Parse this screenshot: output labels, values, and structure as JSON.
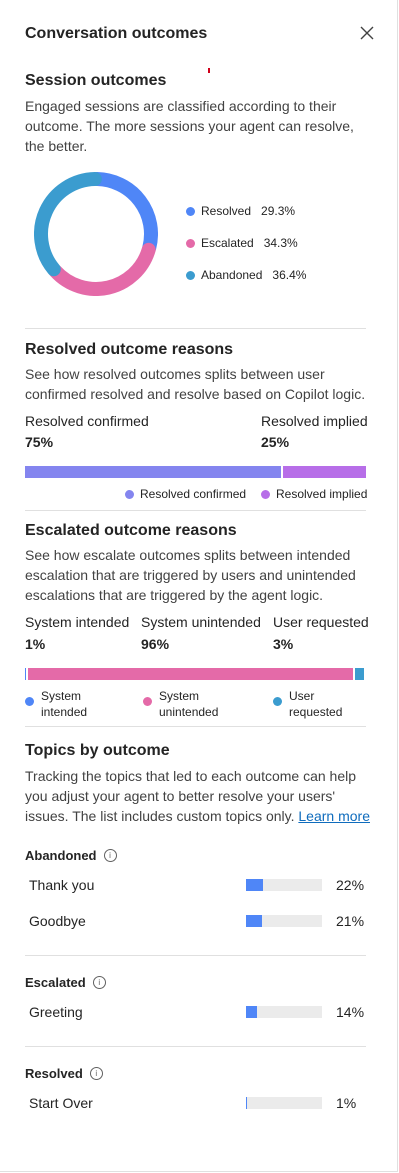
{
  "header": {
    "title": "Conversation outcomes",
    "close_icon": "close-icon"
  },
  "session": {
    "title": "Session outcomes",
    "description": "Engaged sessions are classified according to their outcome. The more sessions your agent can resolve, the better.",
    "legend": [
      {
        "label": "Resolved",
        "pct": "29.3%",
        "value": 29.3,
        "color": "#4f86f7"
      },
      {
        "label": "Escalated",
        "pct": "34.3%",
        "value": 34.3,
        "color": "#e46aa8"
      },
      {
        "label": "Abandoned",
        "pct": "36.4%",
        "value": 36.4,
        "color": "#3b9ccf"
      }
    ]
  },
  "resolved": {
    "title": "Resolved outcome reasons",
    "description": "See how resolved outcomes splits between user confirmed resolved and resolve based on Copilot logic.",
    "confirmed_label": "Resolved confirmed",
    "confirmed_value": "75%",
    "implied_label": "Resolved implied",
    "implied_value": "25%",
    "confirmed_fraction": 0.75,
    "legend_confirmed": "Resolved confirmed",
    "legend_implied": "Resolved implied",
    "colors": {
      "confirmed": "#8485ef",
      "implied": "#b76ee8"
    }
  },
  "escalated": {
    "title": "Escalated outcome reasons",
    "description": "See how escalate outcomes splits between intended escalation that are triggered by users and unintended escalations that are triggered by the agent logic.",
    "metrics": [
      {
        "label": "System intended",
        "value": "1%"
      },
      {
        "label": "System unintended",
        "value": "96%"
      },
      {
        "label": "User requested",
        "value": "3%"
      }
    ],
    "fractions": [
      0.01,
      0.96,
      0.03
    ],
    "legend": [
      {
        "line1": "System",
        "line2": "intended",
        "color": "#4f86f7"
      },
      {
        "line1": "System",
        "line2": "unintended",
        "color": "#e46aa8"
      },
      {
        "line1": "User",
        "line2": "requested",
        "color": "#3b9ccf"
      }
    ]
  },
  "topics": {
    "title": "Topics by outcome",
    "description": "Tracking the topics that led to each outcome can help you adjust your agent to better resolve your users' issues. The list includes custom topics only.",
    "learn_more": "Learn more",
    "groups": [
      {
        "name": "Abandoned",
        "items": [
          {
            "name": "Thank you",
            "pct": "22%",
            "value": 0.22
          },
          {
            "name": "Goodbye",
            "pct": "21%",
            "value": 0.21
          }
        ]
      },
      {
        "name": "Escalated",
        "items": [
          {
            "name": "Greeting",
            "pct": "14%",
            "value": 0.14
          }
        ]
      },
      {
        "name": "Resolved",
        "items": [
          {
            "name": "Start Over",
            "pct": "1%",
            "value": 0.01
          }
        ]
      }
    ]
  }
}
